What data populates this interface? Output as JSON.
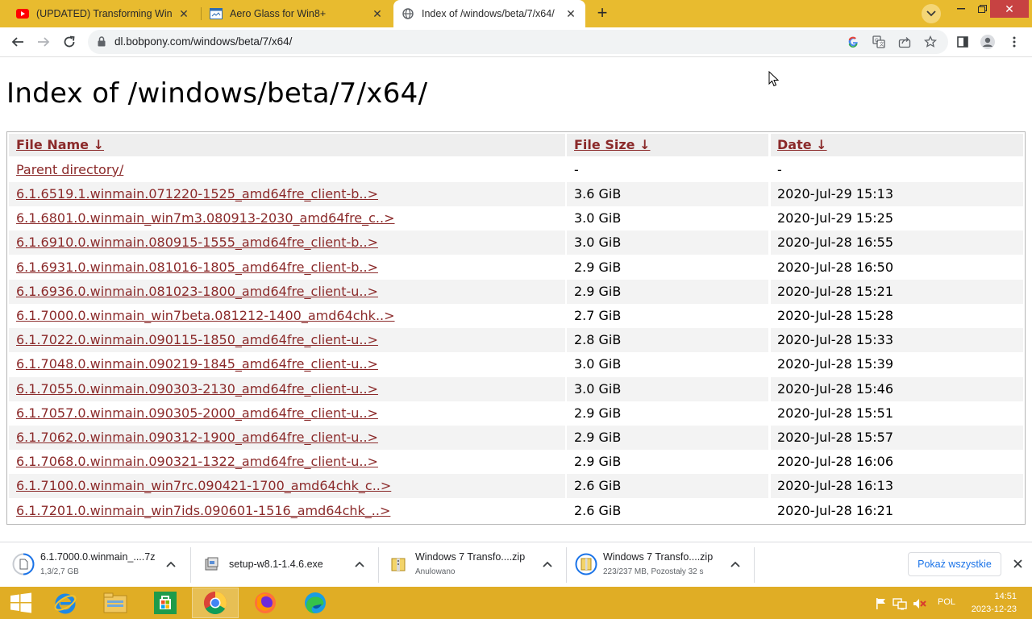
{
  "tabs": [
    {
      "title": "(UPDATED) Transforming Windo",
      "favicon": "youtube-icon",
      "active": false
    },
    {
      "title": "Aero Glass for Win8+",
      "favicon": "window-favicon-icon",
      "active": false
    },
    {
      "title": "Index of /windows/beta/7/x64/",
      "favicon": "globe-icon",
      "active": true
    }
  ],
  "address_bar": {
    "url": "dl.bobpony.com/windows/beta/7/x64/"
  },
  "page": {
    "title": "Index of /windows/beta/7/x64/",
    "columns": [
      "File Name  ↓",
      "File Size  ↓",
      "Date  ↓"
    ],
    "parent": {
      "name": "Parent directory/",
      "size": "-",
      "date": "-"
    },
    "rows": [
      {
        "name": "6.1.6519.1.winmain.071220-1525_amd64fre_client-b..>",
        "size": "3.6 GiB",
        "date": "2020-Jul-29 15:13"
      },
      {
        "name": "6.1.6801.0.winmain_win7m3.080913-2030_amd64fre_c..>",
        "size": "3.0 GiB",
        "date": "2020-Jul-29 15:25"
      },
      {
        "name": "6.1.6910.0.winmain.080915-1555_amd64fre_client-b..>",
        "size": "3.0 GiB",
        "date": "2020-Jul-28 16:55"
      },
      {
        "name": "6.1.6931.0.winmain.081016-1805_amd64fre_client-b..>",
        "size": "2.9 GiB",
        "date": "2020-Jul-28 16:50"
      },
      {
        "name": "6.1.6936.0.winmain.081023-1800_amd64fre_client-u..>",
        "size": "2.9 GiB",
        "date": "2020-Jul-28 15:21"
      },
      {
        "name": "6.1.7000.0.winmain_win7beta.081212-1400_amd64chk..>",
        "size": "2.7 GiB",
        "date": "2020-Jul-28 15:28"
      },
      {
        "name": "6.1.7022.0.winmain.090115-1850_amd64fre_client-u..>",
        "size": "2.8 GiB",
        "date": "2020-Jul-28 15:33"
      },
      {
        "name": "6.1.7048.0.winmain.090219-1845_amd64fre_client-u..>",
        "size": "3.0 GiB",
        "date": "2020-Jul-28 15:39"
      },
      {
        "name": "6.1.7055.0.winmain.090303-2130_amd64fre_client-u..>",
        "size": "3.0 GiB",
        "date": "2020-Jul-28 15:46"
      },
      {
        "name": "6.1.7057.0.winmain.090305-2000_amd64fre_client-u..>",
        "size": "2.9 GiB",
        "date": "2020-Jul-28 15:51"
      },
      {
        "name": "6.1.7062.0.winmain.090312-1900_amd64fre_client-u..>",
        "size": "2.9 GiB",
        "date": "2020-Jul-28 15:57"
      },
      {
        "name": "6.1.7068.0.winmain.090321-1322_amd64fre_client-u..>",
        "size": "2.9 GiB",
        "date": "2020-Jul-28 16:06"
      },
      {
        "name": "6.1.7100.0.winmain_win7rc.090421-1700_amd64chk_c..>",
        "size": "2.6 GiB",
        "date": "2020-Jul-28 16:13"
      },
      {
        "name": "6.1.7201.0.winmain_win7ids.090601-1516_amd64chk_..>",
        "size": "2.6 GiB",
        "date": "2020-Jul-28 16:21"
      }
    ]
  },
  "downloads": [
    {
      "name": "6.1.7000.0.winmain_....7z",
      "status": "1,3/2,7 GB",
      "icon": "file-icon"
    },
    {
      "name": "setup-w8.1-1.4.6.exe",
      "status": "",
      "icon": "installer-icon"
    },
    {
      "name": "Windows 7 Transfo....zip",
      "status": "Anulowano",
      "icon": "zip-icon"
    },
    {
      "name": "Windows 7 Transfo....zip",
      "status": "223/237 MB, Pozostały 32 s",
      "icon": "zip-icon"
    }
  ],
  "download_bar": {
    "show_all": "Pokaż wszystkie"
  },
  "taskbar": {
    "apps": [
      "internet-explorer-icon",
      "file-explorer-icon",
      "store-icon",
      "chrome-icon",
      "firefox-icon",
      "edge-icon"
    ],
    "language": "POL",
    "time": "14:51",
    "date": "2023-12-23"
  },
  "colors": {
    "tabstrip": "#e8bb2f",
    "taskbar": "#e0ad25",
    "link": "#8b2a2a",
    "accent_blue": "#1a73e8"
  }
}
